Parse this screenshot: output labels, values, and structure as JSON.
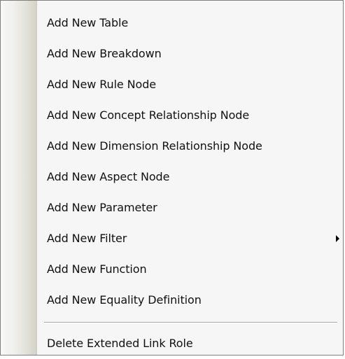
{
  "context_menu": {
    "items": [
      {
        "label": "Add New Table"
      },
      {
        "label": "Add New Breakdown"
      },
      {
        "label": "Add New Rule Node"
      },
      {
        "label": "Add New Concept Relationship Node"
      },
      {
        "label": "Add New Dimension Relationship Node"
      },
      {
        "label": "Add New Aspect Node"
      },
      {
        "label": "Add New Parameter"
      },
      {
        "label": "Add New Filter",
        "has_submenu": true
      },
      {
        "label": "Add New Function"
      },
      {
        "label": "Add New Equality Definition"
      },
      {
        "label": "Delete Extended Link Role"
      }
    ]
  },
  "colors": {
    "menu_background": "#f6f6f6",
    "menu_border": "#7f7f7f",
    "gutter": "#d5d2c6",
    "text": "#111111"
  }
}
